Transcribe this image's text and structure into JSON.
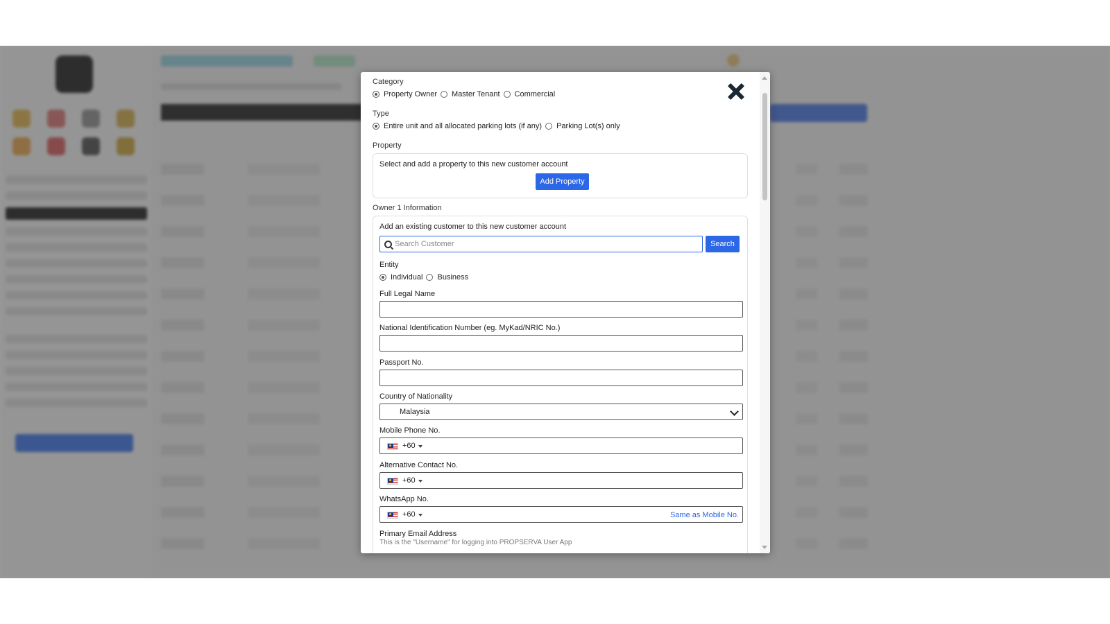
{
  "modal": {
    "category": {
      "label": "Category",
      "options": [
        "Property Owner",
        "Master Tenant",
        "Commercial"
      ],
      "selected": "Property Owner"
    },
    "type": {
      "label": "Type",
      "options": [
        "Entire unit and all allocated parking lots (if any)",
        "Parking Lot(s) only"
      ],
      "selected": "Entire unit and all allocated parking lots (if any)"
    },
    "property": {
      "label": "Property",
      "instruction": "Select and add a property to this new customer account",
      "add_button": "Add Property"
    },
    "owner": {
      "section_label": "Owner 1 Information",
      "existing_prompt": "Add an existing customer to this new customer account",
      "search_placeholder": "Search Customer",
      "search_button": "Search",
      "entity": {
        "label": "Entity",
        "options": [
          "Individual",
          "Business"
        ],
        "selected": "Individual"
      },
      "full_name_label": "Full Legal Name",
      "national_id_label": "National Identification Number (eg. MyKad/NRIC No.)",
      "passport_label": "Passport No.",
      "country_label": "Country of Nationality",
      "country_value": "Malaysia",
      "mobile_label": "Mobile Phone No.",
      "mobile_code": "+60",
      "alt_contact_label": "Alternative Contact No.",
      "alt_contact_code": "+60",
      "whatsapp_label": "WhatsApp No.",
      "whatsapp_code": "+60",
      "same_as_mobile": "Same as Mobile No.",
      "email_label": "Primary Email Address",
      "email_hint": "This is the \"Username\" for logging into PROPSERVA User App"
    }
  },
  "icons": {
    "close": "close-icon",
    "search": "search-icon",
    "country_select": "chevron-down-icon",
    "flag": "malaysia-flag-icon"
  },
  "colors": {
    "primary": "#2b67e6",
    "overlay": "#464646"
  }
}
